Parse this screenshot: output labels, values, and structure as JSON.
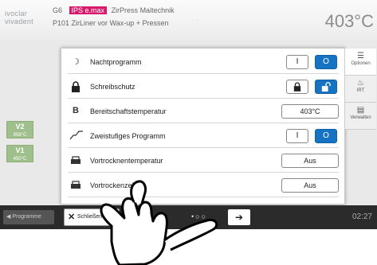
{
  "header": {
    "logo_line1": "ivoclar",
    "logo_line2": "vivadent",
    "program_id": "G6",
    "badge": "IPS e.max",
    "program_name": "ZirPress Maltechnik",
    "program_code": "P101",
    "program_subtitle": "ZirLiner vor Wax-up + Pressen",
    "temperature": "403°C"
  },
  "background": {
    "v2_label": "V2",
    "v2_value": "959°C",
    "v1_label": "V1",
    "v1_value": "450°C",
    "programs_button": "Programme",
    "time": "02:27"
  },
  "dialog": {
    "rows": [
      {
        "label": "Nachtprogramm",
        "icon": "night-program-icon"
      },
      {
        "label": "Schreibschutz",
        "icon": "lock-icon"
      },
      {
        "label": "Bereitschaftstemperatur",
        "icon": "standby-temperature-icon",
        "icon_text": "B",
        "value": "403°C"
      },
      {
        "label": "Zweistufiges Programm",
        "icon": "two-stage-curve-icon"
      },
      {
        "label": "Vortrocknentemperatur",
        "icon": "predrying-temperature-icon",
        "value": "Aus"
      },
      {
        "label": "Vortrockenzeit",
        "icon": "predrying-time-icon",
        "value": "Aus"
      }
    ],
    "toggle_on_symbol": "I",
    "toggle_off_symbol": "O",
    "tabs": {
      "options": "Optionen",
      "irt": "IRT",
      "manage": "Verwalten"
    }
  },
  "bottom": {
    "close_label": "Schließen",
    "page_dots": "•○○",
    "next_symbol": "➔"
  },
  "colors": {
    "accent_blue": "#1673c4",
    "badge_pink": "#d8196b",
    "vbtn_green": "#9fbf8c"
  }
}
